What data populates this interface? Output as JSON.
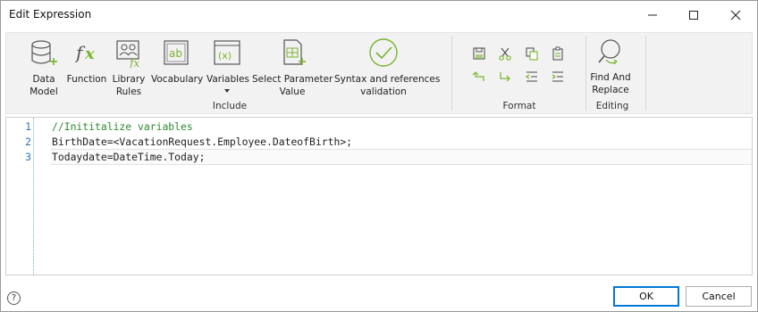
{
  "window": {
    "title": "Edit Expression"
  },
  "ribbon": {
    "buttons": [
      {
        "label": "Data\nModel",
        "icon": "database-add-icon"
      },
      {
        "label": "Function",
        "icon": "function-fx-icon"
      },
      {
        "label": "Library\nRules",
        "icon": "library-rules-icon"
      },
      {
        "label": "Vocabulary",
        "icon": "vocabulary-ab-icon"
      },
      {
        "label": "Variables",
        "icon": "variables-x-icon"
      },
      {
        "label": "Select Parameter\nValue",
        "icon": "select-parameter-icon"
      },
      {
        "label": "Syntax and references\nvalidation",
        "icon": "validation-check-icon"
      },
      {
        "label": "Find And\nReplace",
        "icon": "find-replace-icon"
      }
    ],
    "groups": {
      "include": "Include",
      "format": "Format",
      "editing": "Editing"
    },
    "format_tools": [
      "save-icon",
      "cut-icon",
      "copy-icon",
      "paste-icon",
      "undo-icon",
      "redo-icon",
      "outdent-icon",
      "indent-icon"
    ]
  },
  "editor": {
    "lines": [
      {
        "number": "1",
        "text": "//Inititalize variables"
      },
      {
        "number": "2",
        "text": "BirthDate=<VacationRequest.Employee.DateofBirth>;"
      },
      {
        "number": "3",
        "text": "Todaydate=DateTime.Today;"
      }
    ]
  },
  "footer": {
    "help": "?",
    "ok": "OK",
    "cancel": "Cancel"
  },
  "colors": {
    "accent": "#0078d7",
    "icon_green": "#7ab32e",
    "comment": "#2e8b2e",
    "line_number": "#2b74b8"
  }
}
